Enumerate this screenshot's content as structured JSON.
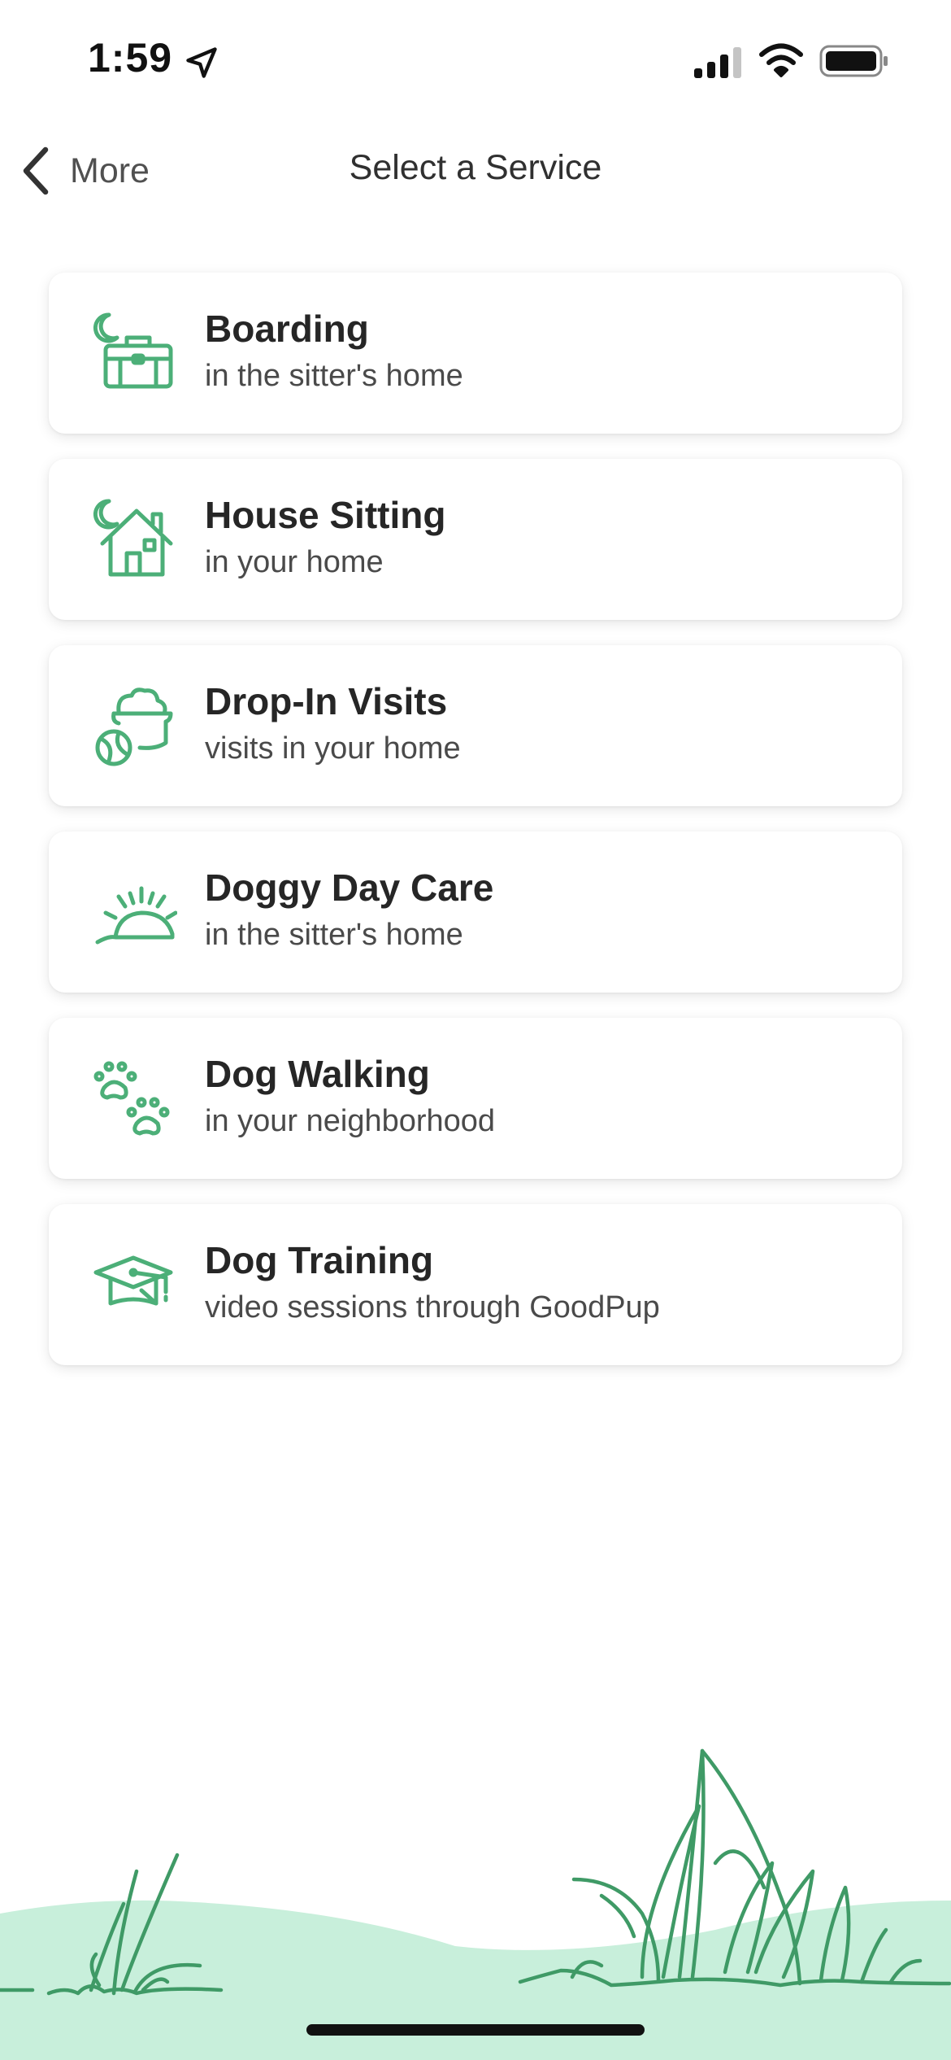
{
  "status_bar": {
    "time": "1:59"
  },
  "nav": {
    "back_label": "More",
    "title": "Select a Service"
  },
  "colors": {
    "accent": "#4caf78",
    "grass_fill": "#c8efdb",
    "grass_stroke": "#3f9a66"
  },
  "services": [
    {
      "icon": "boarding-icon",
      "title": "Boarding",
      "subtitle": "in the sitter's home"
    },
    {
      "icon": "house-sitting-icon",
      "title": "House Sitting",
      "subtitle": "in your home"
    },
    {
      "icon": "drop-in-visits-icon",
      "title": "Drop-In Visits",
      "subtitle": "visits in your home"
    },
    {
      "icon": "doggy-day-care-icon",
      "title": "Doggy Day Care",
      "subtitle": "in the sitter's home"
    },
    {
      "icon": "dog-walking-icon",
      "title": "Dog Walking",
      "subtitle": "in your neighborhood"
    },
    {
      "icon": "dog-training-icon",
      "title": "Dog Training",
      "subtitle": "video sessions through GoodPup"
    }
  ]
}
